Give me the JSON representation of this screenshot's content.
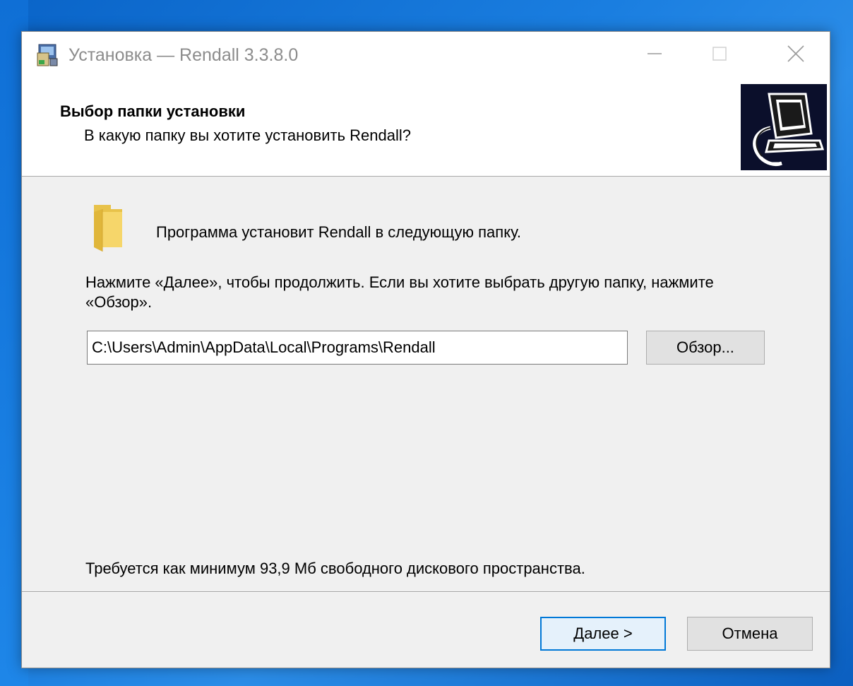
{
  "window": {
    "title": "Установка — Rendall 3.3.8.0",
    "icon": "installer-icon",
    "controls": [
      "minimize-icon",
      "maximize-icon",
      "close-icon"
    ]
  },
  "header": {
    "title": "Выбор папки установки",
    "subtitle": "В какую папку вы хотите установить Rendall?",
    "image": "computer-install-icon"
  },
  "main": {
    "folder_icon": "folder-icon",
    "lead_text": "Программа установит Rendall в следующую папку.",
    "instruction": "Нажмите «Далее», чтобы продолжить. Если вы хотите выбрать другую папку, нажмите «Обзор».",
    "install_path": "C:\\Users\\Admin\\AppData\\Local\\Programs\\Rendall",
    "browse_label": "Обзор...",
    "disk_space": "Требуется как минимум 93,9 Мб свободного дискового пространства."
  },
  "footer": {
    "next_label": "Далее >",
    "cancel_label": "Отмена"
  },
  "colors": {
    "accent": "#0078d7",
    "desktop": "#1a7ee0",
    "dialog_bg": "#f0f0f0"
  }
}
